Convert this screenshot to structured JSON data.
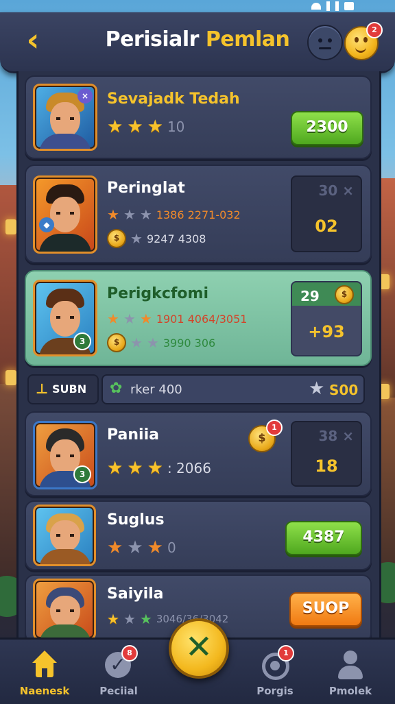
{
  "header": {
    "back_icon": "chevron-left-icon",
    "title_part1": "Perisialr",
    "title_part2": "Pemlan",
    "profile_notification_count": "2"
  },
  "players": [
    {
      "name": "Sevajadk Tedah",
      "stars": [
        "gold",
        "gold",
        "gold"
      ],
      "stat_text": "10",
      "action": "2300",
      "action_type": "green-button"
    },
    {
      "name": "Peringlat",
      "stat_line1": "1386 2271-032",
      "stat_line2": "9247 4308",
      "box_top": "30 ×",
      "box_value": "02"
    },
    {
      "name": "Perigkcfomi",
      "stat_line1": "1901 4064/3051",
      "stat_line2": "3990 306",
      "box_top": "29",
      "box_value": "+93",
      "avatar_badge": "3",
      "selected": true
    },
    {
      "name": "Paniia",
      "stars": [
        "gold",
        "gold",
        "gold"
      ],
      "stat_text": ": 2066",
      "box_top": "38 ×",
      "box_value": "18",
      "avatar_badge": "3",
      "coin_notification": "1"
    },
    {
      "name": "Suglus",
      "stars": [
        "orange",
        "grey",
        "orange"
      ],
      "stat_text": "0",
      "action": "4387",
      "action_type": "green-button"
    },
    {
      "name": "Saiyila",
      "stars": [
        "gold",
        "grey",
        "green"
      ],
      "stat_text": "3046/36/3042",
      "action": "SUOP",
      "action_type": "orange-button"
    }
  ],
  "summary": {
    "left_label": "SUBN",
    "mid_text": "rker 400",
    "right_value": "S00"
  },
  "nav": {
    "items": [
      {
        "label": "Naenesk",
        "icon": "home-icon"
      },
      {
        "label": "Peciial",
        "icon": "check-badge-icon",
        "badge": "8"
      },
      {
        "label": "Porgis",
        "icon": "target-icon",
        "badge": "1"
      },
      {
        "label": "Pmolek",
        "icon": "person-icon"
      }
    ],
    "center_icon": "close-icon"
  }
}
